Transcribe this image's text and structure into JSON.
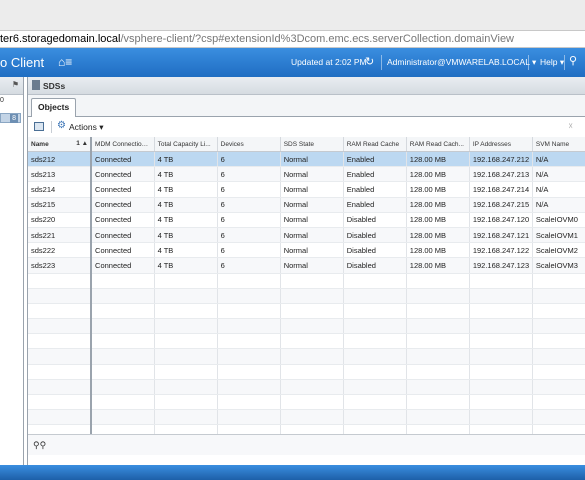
{
  "browser": {
    "url_host": "ter6.storagedomain.local",
    "url_path": "/vsphere-client/?csp#extensionId%3Dcom.emc.ecs.serverCollection.domainView"
  },
  "header": {
    "app_title": "o Client",
    "home_icon": "home-menu-icon",
    "updated": "Updated at 2:02 PM",
    "refresh_icon": "refresh-icon",
    "user": "Administrator@VMWARELAB.LOCAL ▾",
    "help": "Help ▾",
    "search_icon": "search-icon"
  },
  "left_panel": {
    "pin_icon": "pin-icon",
    "row1": "0",
    "badge": "8"
  },
  "panel": {
    "title": "SDSs",
    "tab": "Objects",
    "actions_label": "Actions ▾"
  },
  "columns": [
    "Name",
    "MDM Connection...",
    "Total Capacity Li...",
    "Devices",
    "SDS State",
    "RAM Read Cache",
    "RAM Read Cach...",
    "IP Addresses",
    "SVM Name"
  ],
  "sort_indicator": "1 ▲",
  "rows": [
    [
      "sds212",
      "Connected",
      "4 TB",
      "6",
      "Normal",
      "Enabled",
      "128.00 MB",
      "192.168.247.212",
      "N/A"
    ],
    [
      "sds213",
      "Connected",
      "4 TB",
      "6",
      "Normal",
      "Enabled",
      "128.00 MB",
      "192.168.247.213",
      "N/A"
    ],
    [
      "sds214",
      "Connected",
      "4 TB",
      "6",
      "Normal",
      "Enabled",
      "128.00 MB",
      "192.168.247.214",
      "N/A"
    ],
    [
      "sds215",
      "Connected",
      "4 TB",
      "6",
      "Normal",
      "Enabled",
      "128.00 MB",
      "192.168.247.215",
      "N/A"
    ],
    [
      "sds220",
      "Connected",
      "4 TB",
      "6",
      "Normal",
      "Disabled",
      "128.00 MB",
      "192.168.247.120",
      "ScaleIOVM0"
    ],
    [
      "sds221",
      "Connected",
      "4 TB",
      "6",
      "Normal",
      "Disabled",
      "128.00 MB",
      "192.168.247.121",
      "ScaleIOVM1"
    ],
    [
      "sds222",
      "Connected",
      "4 TB",
      "6",
      "Normal",
      "Disabled",
      "128.00 MB",
      "192.168.247.122",
      "ScaleIOVM2"
    ],
    [
      "sds223",
      "Connected",
      "4 TB",
      "6",
      "Normal",
      "Disabled",
      "128.00 MB",
      "192.168.247.123",
      "ScaleIOVM3"
    ]
  ],
  "selected_row": 0,
  "colors": {
    "header_blue": "#2f7fd6",
    "selected_row": "#bcd8f1"
  }
}
